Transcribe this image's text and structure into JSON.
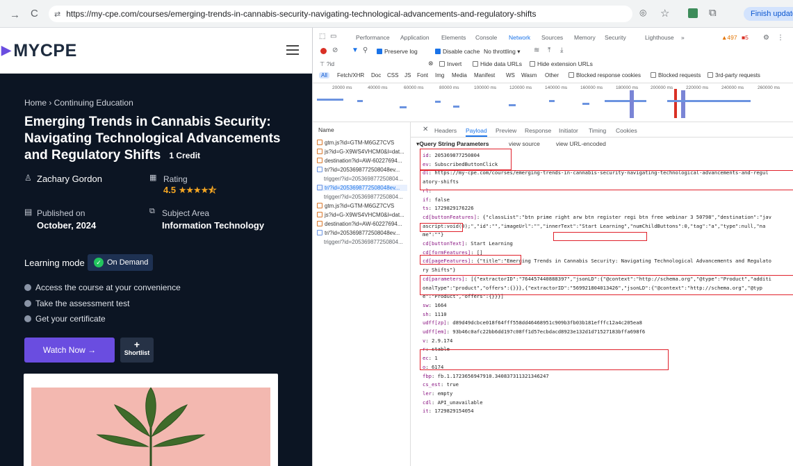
{
  "browser": {
    "url": "https://my-cpe.com/courses/emerging-trends-in-cannabis-security-navigating-technological-advancements-and-regulatory-shifts",
    "finish_update": "Finish update"
  },
  "site": {
    "logo": "MYCPE",
    "breadcrumb": "Home › Continuing Education",
    "title": "Emerging Trends in Cannabis Security: Navigating Technological Advancements and Regulatory Shifts",
    "credit": "1 Credit",
    "author": "Zachary Gordon",
    "rating_label": "Rating",
    "rating_value": "4.5",
    "rating_stars": 4.5,
    "published_label": "Published on",
    "published_value": "October, 2024",
    "subject_label": "Subject Area",
    "subject_value": "Information Technology",
    "learning_mode_label": "Learning mode",
    "learning_mode_value": "On Demand",
    "features": [
      "Access the course at your convenience",
      "Take the assessment test",
      "Get your certificate"
    ],
    "watch_now": "Watch Now →",
    "shortlist": "Shortlist"
  },
  "devtools": {
    "tabs": [
      "Performance",
      "Application",
      "Elements",
      "Console",
      "Network",
      "Sources",
      "Memory",
      "Security",
      "Lighthouse",
      "»"
    ],
    "active_tab": "Network",
    "warn_count": "497",
    "err_count": "5",
    "toolbar": {
      "preserve_log": "Preserve log",
      "disable_cache": "Disable cache",
      "throttling": "No throttling ▾"
    },
    "filter_text": "?id",
    "filter_options": {
      "invert": "Invert",
      "hide_data": "Hide data URLs",
      "hide_ext": "Hide extension URLs"
    },
    "type_filters": [
      "All",
      "Fetch/XHR",
      "Doc",
      "CSS",
      "JS",
      "Font",
      "Img",
      "Media",
      "Manifest",
      "WS",
      "Wasm",
      "Other"
    ],
    "blocked": {
      "cookies": "Blocked response cookies",
      "requests": "Blocked requests",
      "third_party": "3rd-party requests"
    },
    "timeline_ticks": [
      "20000 ms",
      "40000 ms",
      "60000 ms",
      "80000 ms",
      "100000 ms",
      "120000 ms",
      "140000 ms",
      "160000 ms",
      "180000 ms",
      "200000 ms",
      "220000 ms",
      "240000 ms",
      "260000 ms"
    ],
    "name_header": "Name",
    "requests": [
      "gtm.js?id=GTM-M6GZ7CVS",
      "js?id=G-X9WS4VHCM0&l=dat...",
      "destination?id=AW-60227694...",
      "tr/?id=2053698772508048ev...",
      "trigger/?id=205369877250804...",
      "tr/?id=2053698772508048ev...",
      "trigger/?id=205369877250804...",
      "gtm.js?id=GTM-M6GZ7CVS",
      "js?id=G-X9WS4VHCM0&l=dat...",
      "destination?id=AW-60227694...",
      "tr/?id=2053698772508048ev...",
      "trigger/?id=205369877250804..."
    ],
    "detail_tabs": [
      "Headers",
      "Payload",
      "Preview",
      "Response",
      "Initiator",
      "Timing",
      "Cookies"
    ],
    "payload_header": "▾Query String Parameters",
    "view_source": "view source",
    "view_url_encoded": "view URL-encoded",
    "params": [
      {
        "k": "id",
        "v": "205369877250804"
      },
      {
        "k": "ev",
        "v": "SubscribedButtonClick"
      },
      {
        "k": "dl",
        "v": "https://my-cpe.com/courses/emerging-trends-in-cannabis-security-navigating-technological-advancements-and-regul"
      },
      {
        "k": "",
        "v": "atory-shifts"
      },
      {
        "k": "rl",
        "v": ""
      },
      {
        "k": "if",
        "v": "false"
      },
      {
        "k": "ts",
        "v": "1729829176226"
      },
      {
        "k": "cd[buttonFeatures]",
        "v": "{\"classList\":\"btn prime right arw btn register regi btn free webinar 3 50798\",\"destination\":\"jav"
      },
      {
        "k": "",
        "v": "ascript:void(0);\",\"id\":\"\",\"imageUrl\":\"\",\"innerText\":\"Start Learning\",\"numChildButtons\":0,\"tag\":\"a\",\"type\":null,\"na"
      },
      {
        "k": "",
        "v": "me\":\"\"}"
      },
      {
        "k": "cd[buttonText]",
        "v": "Start Learning"
      },
      {
        "k": "cd[formFeatures]",
        "v": "[]"
      },
      {
        "k": "cd[pageFeatures]",
        "v": "{\"title\":\"Emerging Trends in Cannabis Security: Navigating Technological Advancements and Regulato"
      },
      {
        "k": "",
        "v": "ry Shifts\"}"
      },
      {
        "k": "cd[parameters]",
        "v": "[{\"extractorID\":\"764457440888397\",\"jsonLD\":{\"@context\":\"http://schema.org\",\"@type\":\"Product\",\"additi"
      },
      {
        "k": "",
        "v": "onalType\":\"product\",\"offers\":{}}},{\"extractorID\":\"569921804013426\",\"jsonLD\":{\"@context\":\"http://schema.org\",\"@typ"
      },
      {
        "k": "",
        "v": "e\":\"Product\",\"offers\":{}}}]"
      },
      {
        "k": "sw",
        "v": "1664"
      },
      {
        "k": "sh",
        "v": "1110"
      },
      {
        "k": "udff[zp]",
        "v": "d89d49dcbce018f64fff558dd46468951c909b3fb03b181efffc12a4c205ea8"
      },
      {
        "k": "udff[em]",
        "v": "93b46c0afc22bb6dd197c08ff1d57ecbdacd8923e132d1d71527183bffa698f6"
      },
      {
        "k": "v",
        "v": "2.9.174"
      },
      {
        "k": "r",
        "v": "stable"
      },
      {
        "k": "ec",
        "v": "1"
      },
      {
        "k": "o",
        "v": "6174"
      },
      {
        "k": "fbp",
        "v": "fb.1.1723656947910.340837311321346247"
      },
      {
        "k": "cs_est",
        "v": "true"
      },
      {
        "k": "ler",
        "v": "empty"
      },
      {
        "k": "cdl",
        "v": "API_unavailable"
      },
      {
        "k": "it",
        "v": "1729829154054"
      }
    ]
  },
  "colors": {
    "accent": "#6a4de0",
    "site_bg": "#0c1523",
    "devtools_blue": "#1a73e8",
    "highlight": "#e0202a"
  }
}
